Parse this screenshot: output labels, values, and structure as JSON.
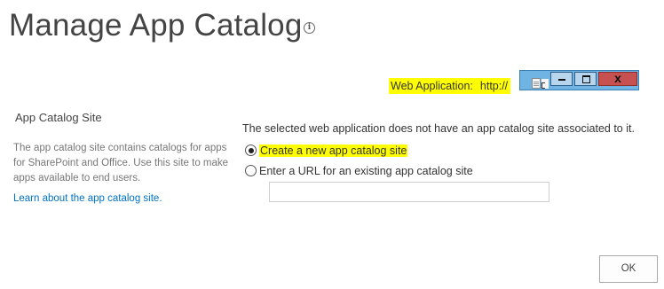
{
  "header": {
    "title": "Manage App Catalog",
    "info_icon_glyph": "i"
  },
  "web_application": {
    "label": "Web Application:",
    "url": "http://"
  },
  "overlay_window": {
    "icon": "document-icon",
    "minimize_icon": "minimize-icon",
    "maximize_icon": "maximize-icon",
    "close_icon": "close-icon"
  },
  "section": {
    "title": "App Catalog Site",
    "description": "The app catalog site contains catalogs for apps for SharePoint and Office. Use this site to make apps available to end users.",
    "learn_link": "Learn about the app catalog site."
  },
  "main": {
    "status": "The selected web application does not have an app catalog site associated to it.",
    "options": [
      {
        "label": "Create a new app catalog site",
        "selected": true
      },
      {
        "label": "Enter a URL for an existing app catalog site",
        "selected": false
      }
    ],
    "url_value": ""
  },
  "footer": {
    "ok_label": "OK"
  },
  "colors": {
    "highlight": "#ffff00",
    "link": "#0072c6",
    "window_titlebar": "#6fb4e3",
    "close_button": "#c75050"
  }
}
